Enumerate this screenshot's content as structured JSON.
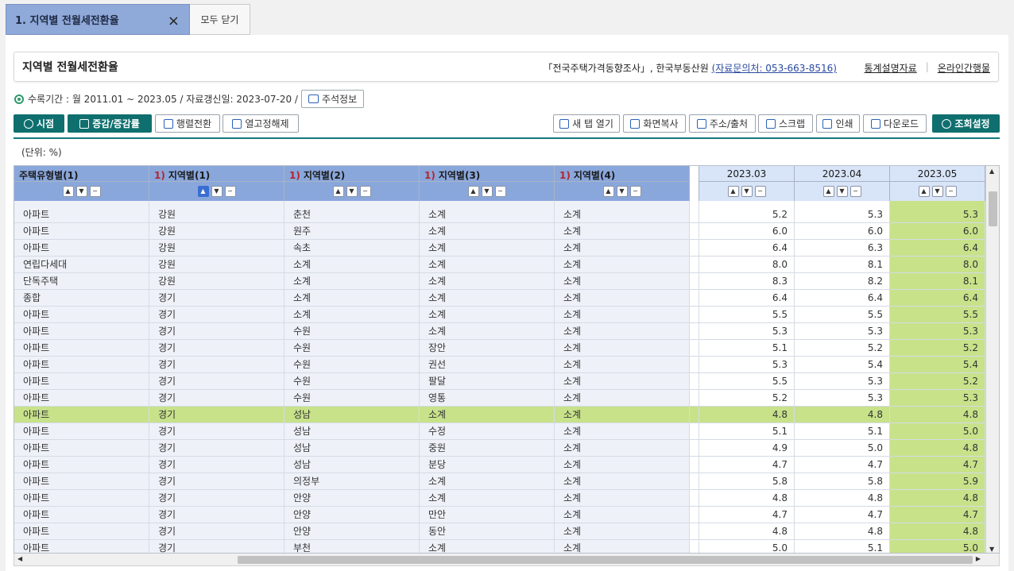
{
  "tabs": {
    "active_label": "1. 지역별 전월세전환율",
    "close_icon": "×",
    "close_all_label": "모두 닫기"
  },
  "header": {
    "title": "지역별 전월세전환율",
    "source_text": "「전국주택가격동향조사」, 한국부동산원 ",
    "source_contact": "(자료문의처: 053-663-8516)",
    "link_stats": "통계설명자료",
    "link_online": "온라인간행물"
  },
  "period": {
    "text": "수록기간 : 월 2011.01 ~ 2023.05 / 자료갱신일: 2023-07-20 /",
    "note_button": "주석정보"
  },
  "toolbar": {
    "timepoint": "시점",
    "increase": "증감/증감률",
    "pivot": "행렬전환",
    "unfreeze": "열고정해제",
    "new_tab": "새 탭 열기",
    "copy_screen": "화면복사",
    "address": "주소/출처",
    "scrap": "스크랩",
    "print": "인쇄",
    "download": "다운로드",
    "query_settings": "조회설정"
  },
  "unit_label": "(단위: %)",
  "table": {
    "dim_headers": [
      {
        "num": "",
        "label": "주택유형별(1)"
      },
      {
        "num": "1)",
        "label": "지역별(1)"
      },
      {
        "num": "1)",
        "label": "지역별(2)"
      },
      {
        "num": "1)",
        "label": "지역별(3)"
      },
      {
        "num": "1)",
        "label": "지역별(4)"
      }
    ],
    "value_headers": [
      "2023.03",
      "2023.04",
      "2023.05"
    ],
    "rows": [
      {
        "cells": [
          "아파트",
          "강원",
          "춘천",
          "소계",
          "소계"
        ],
        "values": [
          "5.2",
          "5.3",
          "5.3"
        ]
      },
      {
        "cells": [
          "아파트",
          "강원",
          "원주",
          "소계",
          "소계"
        ],
        "values": [
          "6.0",
          "6.0",
          "6.0"
        ]
      },
      {
        "cells": [
          "아파트",
          "강원",
          "속초",
          "소계",
          "소계"
        ],
        "values": [
          "6.4",
          "6.3",
          "6.4"
        ]
      },
      {
        "cells": [
          "연립다세대",
          "강원",
          "소계",
          "소계",
          "소계"
        ],
        "values": [
          "8.0",
          "8.1",
          "8.0"
        ]
      },
      {
        "cells": [
          "단독주택",
          "강원",
          "소계",
          "소계",
          "소계"
        ],
        "values": [
          "8.3",
          "8.2",
          "8.1"
        ]
      },
      {
        "cells": [
          "종합",
          "경기",
          "소계",
          "소계",
          "소계"
        ],
        "values": [
          "6.4",
          "6.4",
          "6.4"
        ]
      },
      {
        "cells": [
          "아파트",
          "경기",
          "소계",
          "소계",
          "소계"
        ],
        "values": [
          "5.5",
          "5.5",
          "5.5"
        ]
      },
      {
        "cells": [
          "아파트",
          "경기",
          "수원",
          "소계",
          "소계"
        ],
        "values": [
          "5.3",
          "5.3",
          "5.3"
        ]
      },
      {
        "cells": [
          "아파트",
          "경기",
          "수원",
          "장안",
          "소계"
        ],
        "values": [
          "5.1",
          "5.2",
          "5.2"
        ]
      },
      {
        "cells": [
          "아파트",
          "경기",
          "수원",
          "권선",
          "소계"
        ],
        "values": [
          "5.3",
          "5.4",
          "5.4"
        ]
      },
      {
        "cells": [
          "아파트",
          "경기",
          "수원",
          "팔달",
          "소계"
        ],
        "values": [
          "5.5",
          "5.3",
          "5.2"
        ]
      },
      {
        "cells": [
          "아파트",
          "경기",
          "수원",
          "영통",
          "소계"
        ],
        "values": [
          "5.2",
          "5.3",
          "5.3"
        ]
      },
      {
        "cells": [
          "아파트",
          "경기",
          "성남",
          "소계",
          "소계"
        ],
        "values": [
          "4.8",
          "4.8",
          "4.8"
        ],
        "highlight": true
      },
      {
        "cells": [
          "아파트",
          "경기",
          "성남",
          "수정",
          "소계"
        ],
        "values": [
          "5.1",
          "5.1",
          "5.0"
        ]
      },
      {
        "cells": [
          "아파트",
          "경기",
          "성남",
          "중원",
          "소계"
        ],
        "values": [
          "4.9",
          "5.0",
          "4.8"
        ]
      },
      {
        "cells": [
          "아파트",
          "경기",
          "성남",
          "분당",
          "소계"
        ],
        "values": [
          "4.7",
          "4.7",
          "4.7"
        ]
      },
      {
        "cells": [
          "아파트",
          "경기",
          "의정부",
          "소계",
          "소계"
        ],
        "values": [
          "5.8",
          "5.8",
          "5.9"
        ]
      },
      {
        "cells": [
          "아파트",
          "경기",
          "안양",
          "소계",
          "소계"
        ],
        "values": [
          "4.8",
          "4.8",
          "4.8"
        ]
      },
      {
        "cells": [
          "아파트",
          "경기",
          "안양",
          "만안",
          "소계"
        ],
        "values": [
          "4.7",
          "4.7",
          "4.7"
        ]
      },
      {
        "cells": [
          "아파트",
          "경기",
          "안양",
          "동안",
          "소계"
        ],
        "values": [
          "4.8",
          "4.8",
          "4.8"
        ]
      },
      {
        "cells": [
          "아파트",
          "경기",
          "부천",
          "소계",
          "소계"
        ],
        "values": [
          "5.0",
          "5.1",
          "5.0"
        ]
      }
    ]
  },
  "colors": {
    "accent": "#0f6f6f",
    "tab_active": "#8fa9d9",
    "header_dim": "#8aa7dc",
    "header_value": "#d8e4f7",
    "highlight": "#c8e28a"
  }
}
